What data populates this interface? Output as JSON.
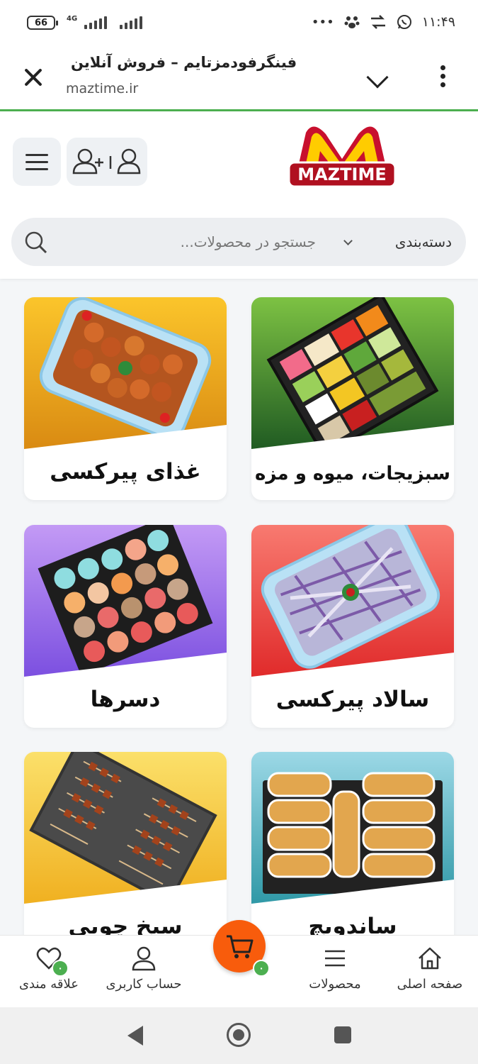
{
  "status_bar": {
    "battery": "66",
    "network": "4G",
    "time": "۱۱:۴۹",
    "icons": [
      "dots-icon",
      "paw-icon",
      "transfer-icon",
      "whatsapp-icon"
    ]
  },
  "browser": {
    "title": "فینگرفودمزتایم – فروش آنلاین",
    "url": "maztime.ir"
  },
  "header": {
    "logo_text": "MAZTIME",
    "search": {
      "placeholder": "جستجو در محصولات...",
      "category_label": "دسته‌بندی"
    }
  },
  "categories": [
    {
      "label": "سبزیجات، میوه و مزه"
    },
    {
      "label": "غذای پیرکسی"
    },
    {
      "label": "سالاد پیرکسی"
    },
    {
      "label": "دسرها"
    },
    {
      "label": "ساندویچ"
    },
    {
      "label": "سیخ چوبی"
    }
  ],
  "bottom_nav": {
    "home": "صفحه اصلی",
    "products": "محصولات",
    "cart_count": "۰",
    "account": "حساب کاربری",
    "wishlist": "علاقه مندی",
    "wishlist_count": "۰"
  },
  "colors": {
    "accent_green": "#4caf50",
    "cart_orange": "#f85c0c"
  }
}
